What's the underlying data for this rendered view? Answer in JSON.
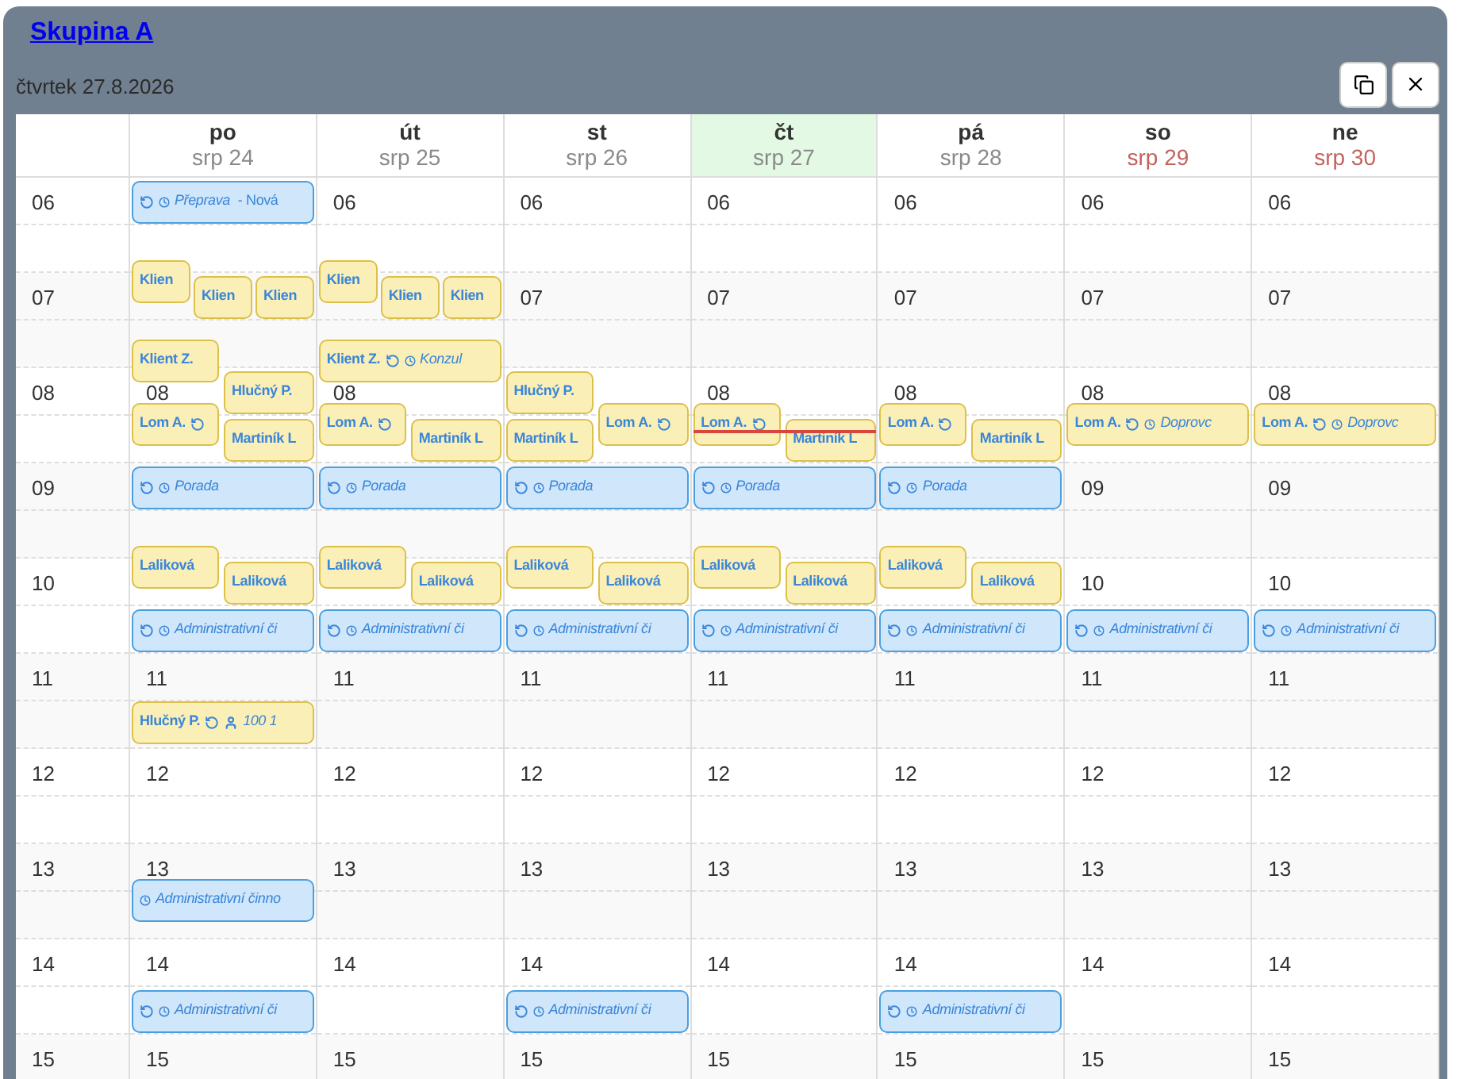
{
  "title": "Skupina A",
  "date": "čtvrtek 27.8.2026",
  "hours": [
    "06",
    "07",
    "08",
    "09",
    "10",
    "11",
    "12",
    "13",
    "14",
    "15"
  ],
  "days": [
    {
      "name": "po",
      "date": "srp 24",
      "today": false,
      "weekend": false,
      "now_marker": false,
      "cells": [
        null,
        null,
        "08",
        null,
        null,
        "11",
        "12",
        "13",
        "14",
        "15"
      ],
      "events": [
        {
          "kind": "activity",
          "recurring": true,
          "timed": true,
          "title": "Přeprava",
          "note": "- Nová"
        },
        {
          "kind": "client",
          "name": "Klien",
          "recurring": false,
          "timed": false
        },
        {
          "kind": "client",
          "name": "Klien",
          "recurring": false,
          "timed": false
        },
        {
          "kind": "client",
          "name": "Klien",
          "recurring": false,
          "timed": false
        },
        {
          "kind": "client",
          "name": "Klient Z.",
          "recurring": false,
          "timed": false
        },
        {
          "kind": "client",
          "name": "Hlučný P.",
          "recurring": false,
          "timed": false
        },
        {
          "kind": "client",
          "name": "Lom A.",
          "recurring": true,
          "timed": false
        },
        {
          "kind": "client",
          "name": "Martiník L",
          "recurring": false,
          "timed": false
        },
        {
          "kind": "activity",
          "recurring": true,
          "timed": true,
          "title": "Porada"
        },
        {
          "kind": "client",
          "name": "Laliková",
          "recurring": false,
          "timed": false
        },
        {
          "kind": "client",
          "name": "Laliková",
          "recurring": false,
          "timed": false
        },
        {
          "kind": "activity",
          "recurring": true,
          "timed": true,
          "title": "Administrativní či"
        },
        {
          "kind": "client",
          "name": "Hlučný P.",
          "recurring": true,
          "timed": false,
          "attendees": "100 1"
        },
        {
          "kind": "activity",
          "recurring": false,
          "timed": true,
          "title": "Administrativní činno"
        },
        {
          "kind": "activity",
          "recurring": true,
          "timed": true,
          "title": "Administrativní či"
        }
      ]
    },
    {
      "name": "út",
      "date": "srp 25",
      "today": false,
      "weekend": false,
      "now_marker": false,
      "cells": [
        "06",
        null,
        "08",
        null,
        null,
        "11",
        "12",
        "13",
        "14",
        "15"
      ],
      "events": [
        {
          "kind": "client",
          "name": "Klien",
          "recurring": false,
          "timed": false
        },
        {
          "kind": "client",
          "name": "Klien",
          "recurring": false,
          "timed": false
        },
        {
          "kind": "client",
          "name": "Klien",
          "recurring": false,
          "timed": false
        },
        {
          "kind": "client",
          "name": "Klient Z.",
          "recurring": true,
          "timed": true,
          "title": "Konzul"
        },
        {
          "kind": "client",
          "name": "Lom A.",
          "recurring": true,
          "timed": false
        },
        {
          "kind": "client",
          "name": "Martiník L",
          "recurring": false,
          "timed": false
        },
        {
          "kind": "activity",
          "recurring": true,
          "timed": true,
          "title": "Porada"
        },
        {
          "kind": "client",
          "name": "Laliková",
          "recurring": false,
          "timed": false
        },
        {
          "kind": "client",
          "name": "Laliková",
          "recurring": false,
          "timed": false
        },
        {
          "kind": "activity",
          "recurring": true,
          "timed": true,
          "title": "Administrativní či"
        }
      ]
    },
    {
      "name": "st",
      "date": "srp 26",
      "today": false,
      "weekend": false,
      "now_marker": false,
      "cells": [
        "06",
        "07",
        null,
        null,
        null,
        "11",
        "12",
        "13",
        "14",
        "15"
      ],
      "events": [
        {
          "kind": "client",
          "name": "Hlučný P.",
          "recurring": false,
          "timed": false
        },
        {
          "kind": "client",
          "name": "Lom A.",
          "recurring": true,
          "timed": false
        },
        {
          "kind": "client",
          "name": "Martiník L",
          "recurring": false,
          "timed": false
        },
        {
          "kind": "activity",
          "recurring": true,
          "timed": true,
          "title": "Porada"
        },
        {
          "kind": "client",
          "name": "Laliková",
          "recurring": false,
          "timed": false
        },
        {
          "kind": "client",
          "name": "Laliková",
          "recurring": false,
          "timed": false
        },
        {
          "kind": "activity",
          "recurring": true,
          "timed": true,
          "title": "Administrativní či"
        },
        {
          "kind": "activity",
          "recurring": true,
          "timed": true,
          "title": "Administrativní či"
        }
      ]
    },
    {
      "name": "čt",
      "date": "srp 27",
      "today": true,
      "weekend": false,
      "now_marker": true,
      "cells": [
        "06",
        "07",
        "08",
        null,
        null,
        "11",
        "12",
        "13",
        "14",
        "15"
      ],
      "events": [
        {
          "kind": "client",
          "name": "Lom A.",
          "recurring": true,
          "timed": false
        },
        {
          "kind": "client",
          "name": "Martiník L",
          "recurring": false,
          "timed": false
        },
        {
          "kind": "activity",
          "recurring": true,
          "timed": true,
          "title": "Porada"
        },
        {
          "kind": "client",
          "name": "Laliková",
          "recurring": false,
          "timed": false
        },
        {
          "kind": "client",
          "name": "Laliková",
          "recurring": false,
          "timed": false
        },
        {
          "kind": "activity",
          "recurring": true,
          "timed": true,
          "title": "Administrativní či"
        }
      ]
    },
    {
      "name": "pá",
      "date": "srp 28",
      "today": false,
      "weekend": false,
      "now_marker": false,
      "cells": [
        "06",
        "07",
        "08",
        null,
        null,
        "11",
        "12",
        "13",
        "14",
        "15"
      ],
      "events": [
        {
          "kind": "client",
          "name": "Lom A.",
          "recurring": true,
          "timed": false
        },
        {
          "kind": "client",
          "name": "Martiník L",
          "recurring": false,
          "timed": false
        },
        {
          "kind": "activity",
          "recurring": true,
          "timed": true,
          "title": "Porada"
        },
        {
          "kind": "client",
          "name": "Laliková",
          "recurring": false,
          "timed": false
        },
        {
          "kind": "client",
          "name": "Laliková",
          "recurring": false,
          "timed": false
        },
        {
          "kind": "activity",
          "recurring": true,
          "timed": true,
          "title": "Administrativní či"
        },
        {
          "kind": "activity",
          "recurring": true,
          "timed": true,
          "title": "Administrativní či"
        }
      ]
    },
    {
      "name": "so",
      "date": "srp 29",
      "today": false,
      "weekend": true,
      "now_marker": false,
      "cells": [
        "06",
        "07",
        "08",
        "09",
        "10",
        "11",
        "12",
        "13",
        "14",
        "15"
      ],
      "events": [
        {
          "kind": "client",
          "name": "Lom A.",
          "recurring": true,
          "timed": true,
          "title": "Doprovc"
        },
        {
          "kind": "activity",
          "recurring": true,
          "timed": true,
          "title": "Administrativní či"
        }
      ]
    },
    {
      "name": "ne",
      "date": "srp 30",
      "today": false,
      "weekend": true,
      "now_marker": false,
      "cells": [
        "06",
        "07",
        "08",
        "09",
        "10",
        "11",
        "12",
        "13",
        "14",
        "15"
      ],
      "events": [
        {
          "kind": "client",
          "name": "Lom A.",
          "recurring": true,
          "timed": true,
          "title": "Doprovc"
        },
        {
          "kind": "activity",
          "recurring": true,
          "timed": true,
          "title": "Administrativní či"
        }
      ]
    }
  ]
}
